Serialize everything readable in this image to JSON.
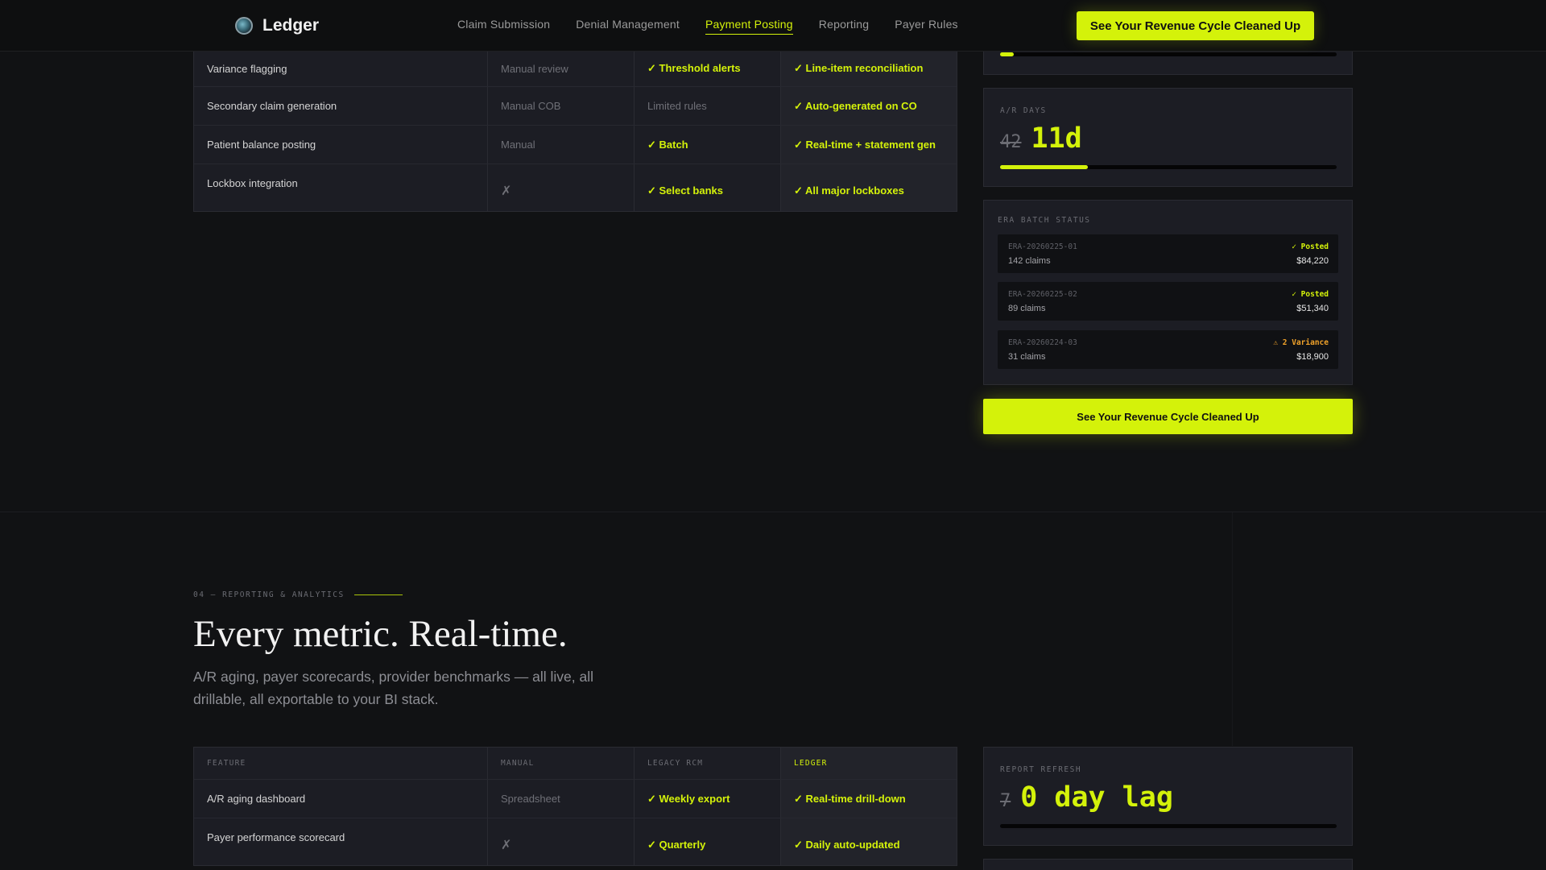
{
  "nav": {
    "brand": "Ledger",
    "links": [
      "Claim Submission",
      "Denial Management",
      "Payment Posting",
      "Reporting",
      "Payer Rules"
    ],
    "active_index": 2,
    "cta": "See Your Revenue Cycle Cleaned Up"
  },
  "table1": {
    "rows": [
      {
        "feature": "Variance flagging",
        "manual": "Manual review",
        "legacy": "✓ Threshold alerts",
        "ledger": "✓ Line-item reconciliation"
      },
      {
        "feature": "Secondary claim generation",
        "manual": "Manual COB",
        "legacy": "Limited rules",
        "ledger": "✓ Auto-generated on CO"
      },
      {
        "feature": "Patient balance posting",
        "manual": "Manual",
        "legacy": "✓ Batch",
        "ledger": "✓ Real-time + statement gen"
      },
      {
        "feature": "Lockbox integration",
        "manual": "✗",
        "legacy": "✓ Select banks",
        "ledger": "✓ All major lockboxes"
      }
    ]
  },
  "ar_days": {
    "label": "A/R DAYS",
    "old": "42",
    "new": "11d",
    "progress": 0.26
  },
  "era": {
    "label": "ERA BATCH STATUS",
    "items": [
      {
        "id": "ERA-20260225-01",
        "claims": "142 claims",
        "status": "✓ Posted",
        "amount": "$84,220",
        "color": "#d4f20a"
      },
      {
        "id": "ERA-20260225-02",
        "claims": "89 claims",
        "status": "✓ Posted",
        "amount": "$51,340",
        "color": "#d4f20a"
      },
      {
        "id": "ERA-20260224-03",
        "claims": "31 claims",
        "status": "⚠ 2 Variance",
        "amount": "$18,900",
        "color": "#f0a22a"
      }
    ]
  },
  "cta_big": "See Your Revenue Cycle Cleaned Up",
  "section": {
    "eyebrow": "04 — REPORTING & ANALYTICS",
    "title": "Every metric. Real-time.",
    "subtitle": "A/R aging, payer scorecards, provider benchmarks — all live, all drillable, all exportable to your BI stack."
  },
  "table2": {
    "headers": [
      "FEATURE",
      "MANUAL",
      "LEGACY RCM",
      "LEDGER"
    ],
    "rows": [
      {
        "feature": "A/R aging dashboard",
        "manual": "Spreadsheet",
        "legacy": "✓ Weekly export",
        "ledger": "✓ Real-time drill-down"
      },
      {
        "feature": "Payer performance scorecard",
        "manual": "✗",
        "legacy": "✓ Quarterly",
        "ledger": "✓ Daily auto-updated"
      }
    ]
  },
  "report_refresh": {
    "label": "REPORT REFRESH",
    "old": "7",
    "new": "0 day lag",
    "progress": 0
  },
  "colors": {
    "accent": "#d4f20a",
    "warning": "#f0a22a",
    "background": "#111214"
  }
}
